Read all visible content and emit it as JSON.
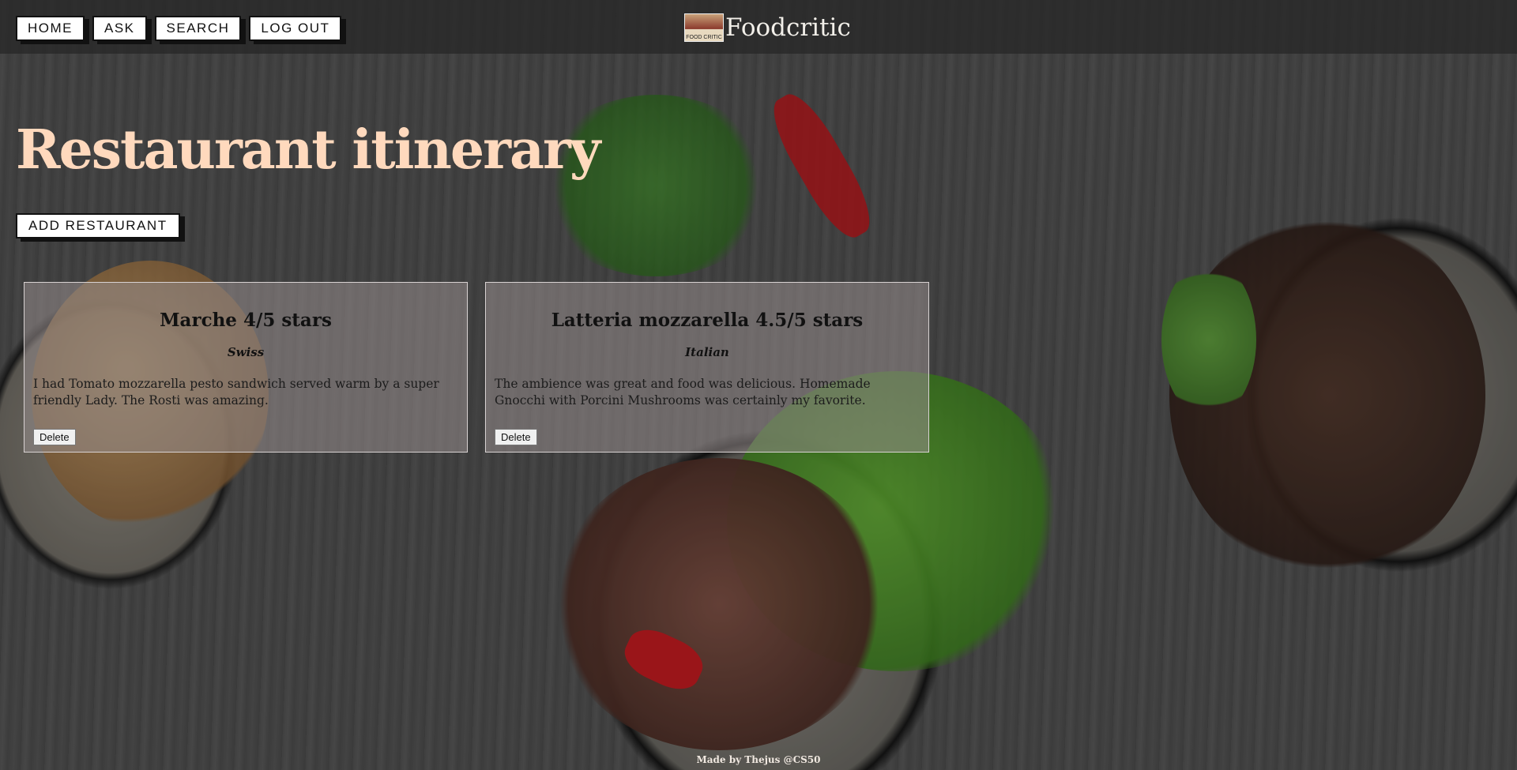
{
  "nav": {
    "home_label": "HOME",
    "ask_label": "ASK",
    "search_label": "SEARCH",
    "logout_label": "LOG OUT"
  },
  "brand": {
    "logo_text": "FOOD CRITIC",
    "name": "Foodcritic"
  },
  "page": {
    "title": "Restaurant itinerary",
    "add_label": "ADD RESTAURANT"
  },
  "cards": [
    {
      "heading": "Marche 4/5 stars",
      "cuisine": "Swiss",
      "review": "I had Tomato mozzarella pesto sandwich served warm by a super friendly Lady. The Rosti was amazing.",
      "delete_label": "Delete"
    },
    {
      "heading": "Latteria mozzarella 4.5/5 stars",
      "cuisine": "Italian",
      "review": "The ambience was great and food was delicious. Homemade Gnocchi with Porcini Mushrooms was certainly my favorite.",
      "delete_label": "Delete"
    }
  ],
  "footer": {
    "text": "Made by Thejus @CS50"
  },
  "colors": {
    "title": "#ffd9bd",
    "topbar": "#2f2f2f",
    "card_bg": "#968c8c"
  }
}
